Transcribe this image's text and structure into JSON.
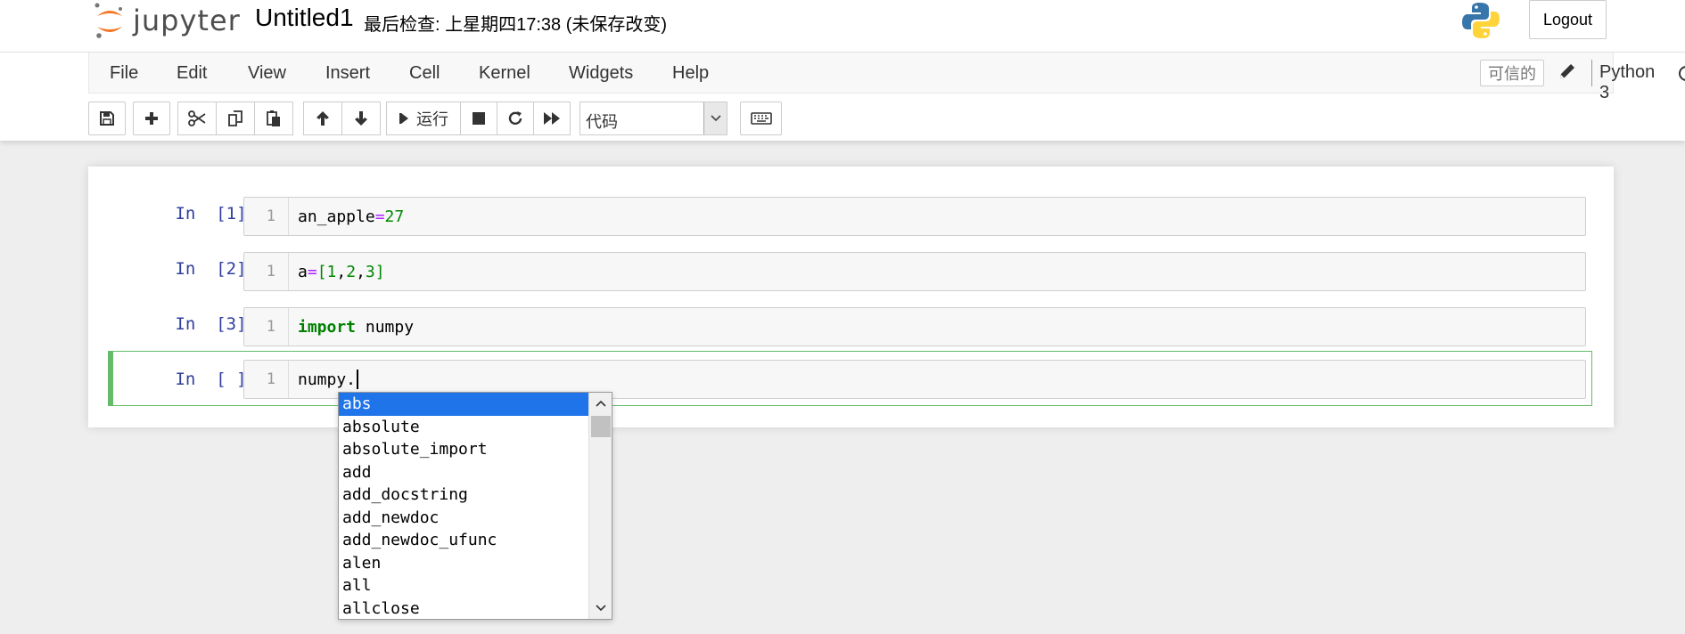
{
  "header": {
    "logo_text": "jupyter",
    "notebook_title": "Untitled1",
    "checkpoint": "最后检查: 上星期四17:38  (未保存改变)",
    "logout_label": "Logout"
  },
  "menubar": {
    "items": [
      "File",
      "Edit",
      "View",
      "Insert",
      "Cell",
      "Kernel",
      "Widgets",
      "Help"
    ],
    "trusted_label": "可信的",
    "kernel_name": "Python 3"
  },
  "toolbar": {
    "run_label": "运行",
    "cell_type": "代码"
  },
  "cells": [
    {
      "prompt": "In  [1]:",
      "line_number": "1",
      "code": "an_apple=27"
    },
    {
      "prompt": "In  [2]:",
      "line_number": "1",
      "code": "a=[1,2,3]"
    },
    {
      "prompt": "In  [3]:",
      "line_number": "1",
      "code": "import numpy"
    },
    {
      "prompt": "In  [ ]:",
      "line_number": "1",
      "code": "numpy."
    }
  ],
  "completer": {
    "items": [
      "abs",
      "absolute",
      "absolute_import",
      "add",
      "add_docstring",
      "add_newdoc",
      "add_newdoc_ufunc",
      "alen",
      "all",
      "allclose"
    ],
    "selected_index": 0
  },
  "colors": {
    "selected_cell_border": "#66bb6a",
    "prompt_color": "#303f9f",
    "completer_highlight": "#1e74e8",
    "logo_orange": "#f37726"
  }
}
